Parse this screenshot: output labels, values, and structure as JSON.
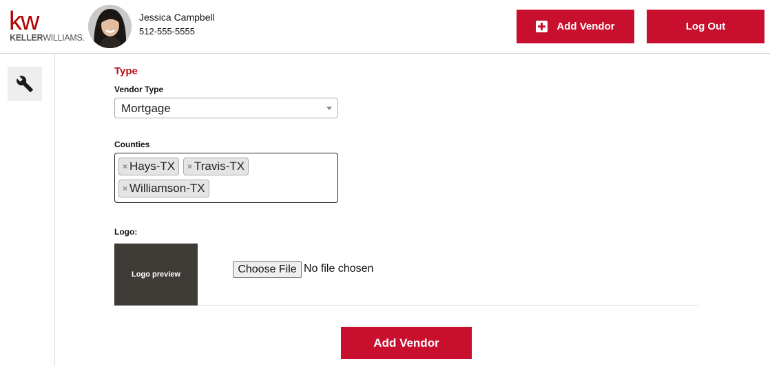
{
  "header": {
    "brand": {
      "kw": "kw",
      "name_bold": "KELLER",
      "name_rest": "WILLIAMS."
    },
    "user": {
      "name": "Jessica Campbell",
      "phone": "512-555-5555"
    },
    "add_vendor_label": "Add Vendor",
    "logout_label": "Log Out"
  },
  "sidebar": {
    "tool_icon": "wrench-icon"
  },
  "form": {
    "section_title": "Type",
    "vendor_type": {
      "label": "Vendor Type",
      "value": "Mortgage"
    },
    "counties": {
      "label": "Counties",
      "tags": [
        "Hays-TX",
        "Travis-TX",
        "Williamson-TX"
      ]
    },
    "logo": {
      "label": "Logo:",
      "preview_text": "Logo preview",
      "choose_file_label": "Choose File",
      "file_status": "No file chosen"
    },
    "submit_label": "Add Vendor"
  },
  "colors": {
    "brand_red": "#c8102e",
    "section_red": "#b5121b",
    "logo_bg": "#3f3b37"
  }
}
